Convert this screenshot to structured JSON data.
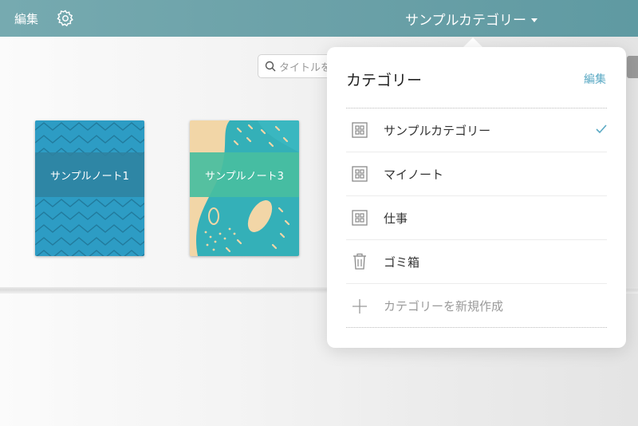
{
  "topbar": {
    "edit_label": "編集",
    "title": "サンプルカテゴリー",
    "icons": [
      "gear-icon",
      "caret-down-icon"
    ]
  },
  "search": {
    "placeholder": "タイトルを"
  },
  "notes": [
    {
      "title": "サンプルノート1",
      "color": "#2d9cc4"
    },
    {
      "title": "サンプルノート3",
      "color": "#48bea0"
    }
  ],
  "popover": {
    "title": "カテゴリー",
    "edit_label": "編集",
    "items": [
      {
        "label": "サンプルカテゴリー",
        "icon": "category-grid-icon",
        "selected": true
      },
      {
        "label": "マイノート",
        "icon": "category-grid-icon",
        "selected": false
      },
      {
        "label": "仕事",
        "icon": "category-grid-icon",
        "selected": false
      },
      {
        "label": "ゴミ箱",
        "icon": "trash-icon",
        "selected": false
      }
    ],
    "add_label": "カテゴリーを新規作成"
  },
  "colors": {
    "topbar": "#6ba1a8",
    "accent": "#5aa9c4"
  }
}
